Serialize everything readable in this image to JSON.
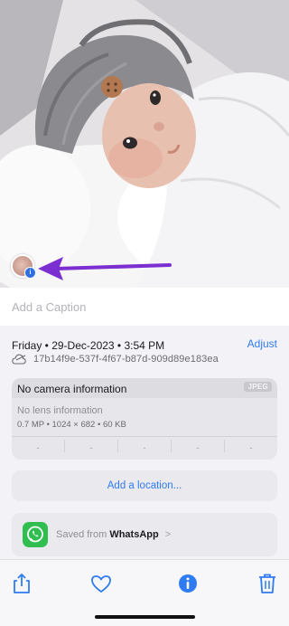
{
  "photo": {
    "face_badge_icon": "person-info-badge",
    "arrow_color": "#7b2fd0"
  },
  "caption": {
    "placeholder": "Add a Caption",
    "value": ""
  },
  "details": {
    "date": "Friday • 29-Dec-2023 • 3:54 PM",
    "adjust_label": "Adjust",
    "cloud_icon": "cloud-icon",
    "file_id": "17b14f9e-537f-4f67-b87d-909d89e183ea"
  },
  "camera": {
    "title": "No camera information",
    "format_badge": "JPEG",
    "lens": "No lens information",
    "meta": "0.7 MP  •  1024 × 682  •  60 KB",
    "exif": [
      "-",
      "-",
      "-",
      "-",
      "-"
    ]
  },
  "location": {
    "label": "Add a location..."
  },
  "saved_from": {
    "prefix": "Saved from",
    "app": "WhatsApp",
    "chevron": ">",
    "icon": "whatsapp-icon"
  },
  "toolbar": {
    "icons": [
      "share-icon",
      "heart-icon",
      "info-icon",
      "trash-icon"
    ],
    "accent": "#2f7bf2"
  }
}
